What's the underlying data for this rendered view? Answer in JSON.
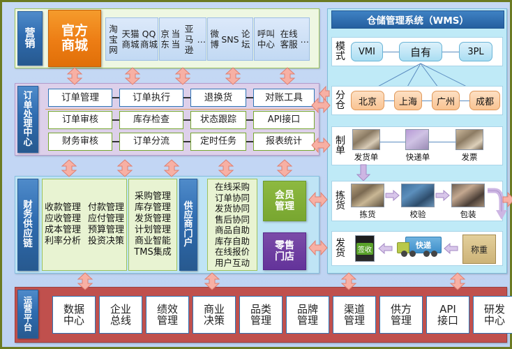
{
  "marketing": {
    "side_label": "营销",
    "mall": "官方商城",
    "channels": [
      "淘宝网\n天猫商城\nQQ商城",
      "京东\n当当\n亚马逊\n…",
      "微博\nSNS\n论坛",
      "呼叫中心\n在线客服\n…"
    ]
  },
  "order_center": {
    "side_label": "订单处理中心",
    "row1": [
      "订单管理",
      "订单执行",
      "退换货",
      "对账工具"
    ],
    "row2": [
      "订单审核",
      "库存检查",
      "状态跟踪",
      "API接口"
    ],
    "row3": [
      "财务审核",
      "订单分流",
      "定时任务",
      "报表统计"
    ]
  },
  "finance": {
    "side_label": "财务供应链",
    "list_left": [
      [
        "收款管理",
        "付款管理"
      ],
      [
        "应收管理",
        "应付管理"
      ],
      [
        "成本管理",
        "预算管理"
      ],
      [
        "利率分析",
        "投资决策"
      ]
    ],
    "list_mid": [
      "采购管理",
      "库存管理",
      "发货管理",
      "计划管理",
      "商业智能",
      "TMS集成"
    ],
    "supplier_side_label": "供应商门户",
    "supplier_list": [
      "在线采购",
      "订单协同",
      "发货协同",
      "售后协同",
      "商品自助",
      "库存自助",
      "在线报价",
      "用户互动"
    ],
    "member": "会员管理",
    "retail": "零售门店"
  },
  "wms": {
    "title": "仓储管理系统（WMS）",
    "mode_label": "模式",
    "modes": [
      "VMI",
      "自有",
      "3PL"
    ],
    "warehouse_label": "分仓",
    "warehouses": [
      "北京",
      "上海",
      "广州",
      "成都"
    ],
    "doc_label": "制单",
    "docs": [
      "发货单",
      "快递单",
      "发票"
    ],
    "pick_label": "拣货",
    "picks": [
      "拣货",
      "校验",
      "包装"
    ],
    "ship_label": "发货",
    "ships": [
      "签收",
      "快递",
      "称重"
    ]
  },
  "ops": {
    "side_label": "运营平台",
    "items": [
      "数据中心",
      "企业总线",
      "绩效管理",
      "商业决策",
      "品类管理",
      "品牌管理",
      "渠道管理",
      "供方管理",
      "API接口",
      "研发中心"
    ]
  },
  "colors": {
    "mall_orange": "#ed7d14",
    "sidebar_blue": "#2f6cb0",
    "member_green": "#78a630",
    "retail_purple": "#63339a",
    "ops_red": "#c0504d",
    "arrow_pink": "#f4a49a",
    "arrow_purple": "#c9b3e0",
    "wms_cyan": "#bfeaf7"
  }
}
